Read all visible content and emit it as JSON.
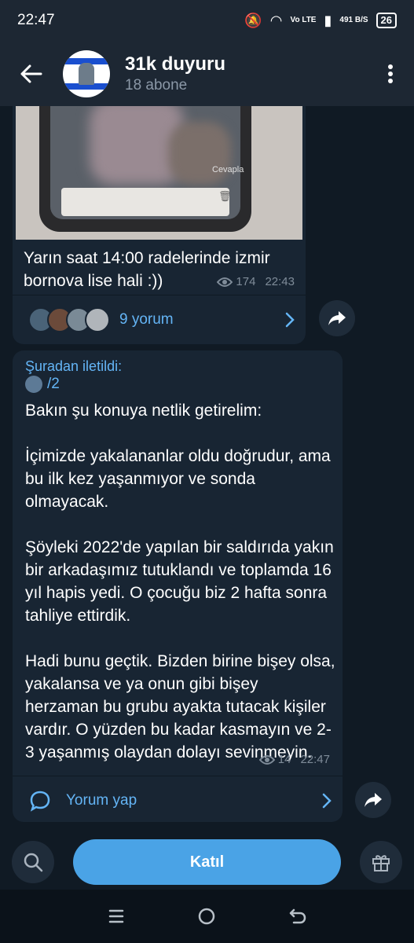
{
  "status_bar": {
    "time": "22:47",
    "network": "Vo LTE",
    "speed": "491 B/S",
    "battery": "26"
  },
  "header": {
    "title": "31k duyuru",
    "subtitle": "18 abone"
  },
  "message1": {
    "photo_reply_chip": "Cevapla",
    "text": "Yarın saat 14:00 radelerinde izmir bornova lise hali :))",
    "views": "174",
    "time": "22:43",
    "comments_label": "9 yorum"
  },
  "message2": {
    "forwarded_label": "Şuradan iletildi:",
    "forwarded_from": "/2",
    "text": "Bakın şu konuya netlik getirelim:\n\nİçimizde yakalananlar oldu doğrudur, ama bu ilk kez yaşanmıyor ve sonda olmayacak.\n\nŞöyleki 2022'de yapılan bir saldırıda yakın bir arkadaşımız tutuklandı ve toplamda 16 yıl hapis yedi. O çocuğu biz 2 hafta sonra tahliye ettirdik.\n\nHadi bunu geçtik. Bizden birine bişey olsa, yakalansa ve ya onun gibi bişey herzaman bu grubu ayakta tutacak kişiler vardır. O yüzden bu kadar kasmayın ve 2-3 yaşanmış olaydan dolayı sevinmeyin.",
    "views": "14",
    "time": "22:47",
    "comment_label": "Yorum yap"
  },
  "bottom_bar": {
    "join_label": "Katıl"
  },
  "colors": {
    "accent": "#4aa3e6",
    "link": "#64b5f6",
    "bubble": "#182533",
    "header": "#1d2733"
  }
}
